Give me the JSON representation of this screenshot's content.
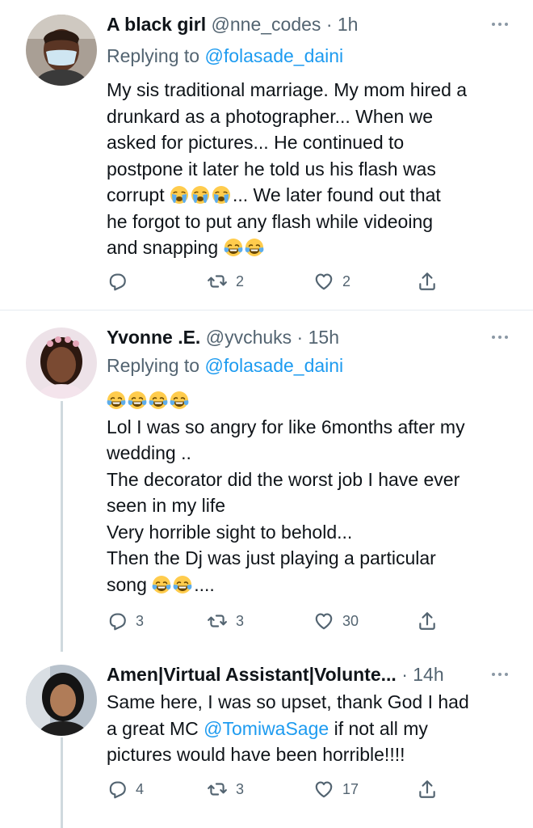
{
  "tweets": [
    {
      "name": "A black girl",
      "handle": "@nne_codes",
      "time": "1h",
      "replying_prefix": "Replying to",
      "replying_to": "@folasade_daini",
      "lines": [
        "My sis traditional marriage. My mom hired a",
        "drunkard as a photographer... When we",
        "asked for pictures... He continued to",
        "postpone it later he told us his flash was",
        "corrupt",
        "... We later found out that",
        "he forgot to put any flash while videoing",
        "and snapping"
      ],
      "reply_count": "",
      "retweet_count": "2",
      "like_count": "2"
    },
    {
      "name": "Yvonne .E.",
      "handle": "@yvchuks",
      "time": "15h",
      "replying_prefix": "Replying to",
      "replying_to": "@folasade_daini",
      "lines": [
        "Lol I was so angry for like 6months after my",
        "wedding ..",
        "The decorator did the worst job I have ever",
        "seen in my life",
        "Very horrible sight to behold...",
        "Then the Dj was just playing a particular",
        "song",
        "...."
      ],
      "reply_count": "3",
      "retweet_count": "3",
      "like_count": "30"
    },
    {
      "name": "Amen|Virtual Assistant|Volunte...",
      "handle": "",
      "time": "14h",
      "lines": [
        "Same here, I was so upset, thank God I had",
        "a great MC",
        "@TomiwaSage",
        "if not all my",
        "pictures would have been horrible!!!!"
      ],
      "reply_count": "4",
      "retweet_count": "3",
      "like_count": "17"
    }
  ],
  "separator": "·",
  "icons": {
    "reply": "reply-icon",
    "retweet": "retweet-icon",
    "like": "heart-icon",
    "share": "share-icon",
    "more": "more-icon",
    "crying_emoji": "loudly-crying-face",
    "laughing_emoji": "tears-of-joy-face"
  },
  "colors": {
    "text": "#0f1419",
    "secondary": "#536471",
    "link": "#1d9bf0",
    "divider": "#e6ecf0",
    "thread_line": "#cfd9de"
  }
}
